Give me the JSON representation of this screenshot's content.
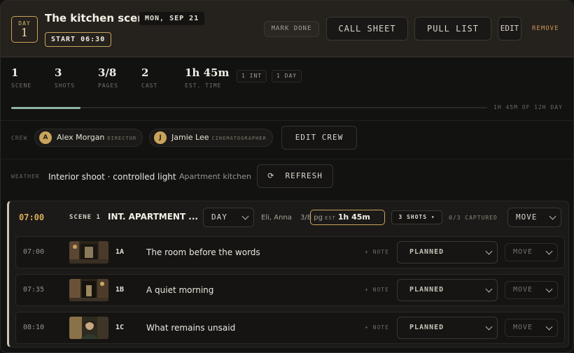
{
  "header": {
    "day_label": "DAY",
    "day_number": "1",
    "title": "The kitchen scene",
    "date": "MON, SEP 21",
    "start": "START 06:30",
    "mark_done": "MARK DONE",
    "call_sheet": "CALL SHEET",
    "pull_list": "PULL LIST",
    "edit": "EDIT",
    "remove": "REMOVE"
  },
  "stats": {
    "items": [
      {
        "value": "1",
        "label": "SCENE"
      },
      {
        "value": "3",
        "label": "SHOTS"
      },
      {
        "value": "3/8",
        "label": "PAGES"
      },
      {
        "value": "2",
        "label": "CAST"
      },
      {
        "value": "1h 45m",
        "label": "EST. TIME"
      }
    ],
    "tags": [
      "1 INT",
      "1 DAY"
    ]
  },
  "progress": {
    "fraction": 0.146,
    "label": "1H 45M OF 12H DAY",
    "color": "#8fb3a5"
  },
  "crew": {
    "label": "CREW",
    "members": [
      {
        "initial": "A",
        "name": "Alex Morgan",
        "role": "DIRECTOR"
      },
      {
        "initial": "J",
        "name": "Jamie Lee",
        "role": "CINEMATOGRAPHER"
      }
    ],
    "edit_label": "EDIT CREW"
  },
  "weather": {
    "label": "WEATHER",
    "summary": "Interior shoot · controlled light",
    "location": "Apartment kitchen",
    "refresh_icon": "⟳",
    "refresh_label": "REFRESH"
  },
  "scene": {
    "time": "07:00",
    "scene_label": "SCENE 1",
    "name": "INT. APARTMENT ...",
    "time_of_day": "DAY",
    "cast": "Eli, Anna",
    "pages": "3/8 pg",
    "est_label": "EST",
    "est_value": "1h 45m",
    "shots_label": "3 SHOTS ▾",
    "captured": "0/3 CAPTURED",
    "move_label": "MOVE",
    "accent": "#d9ad5a"
  },
  "shots": [
    {
      "time": "07:00",
      "id": "1A",
      "title": "The room before the words",
      "note": "+ NOTE",
      "status": "PLANNED",
      "move": "MOVE"
    },
    {
      "time": "07:35",
      "id": "1B",
      "title": "A quiet morning",
      "note": "+ NOTE",
      "status": "PLANNED",
      "move": "MOVE"
    },
    {
      "time": "08:10",
      "id": "1C",
      "title": "What remains unsaid",
      "note": "+ NOTE",
      "status": "PLANNED",
      "move": "MOVE"
    }
  ]
}
